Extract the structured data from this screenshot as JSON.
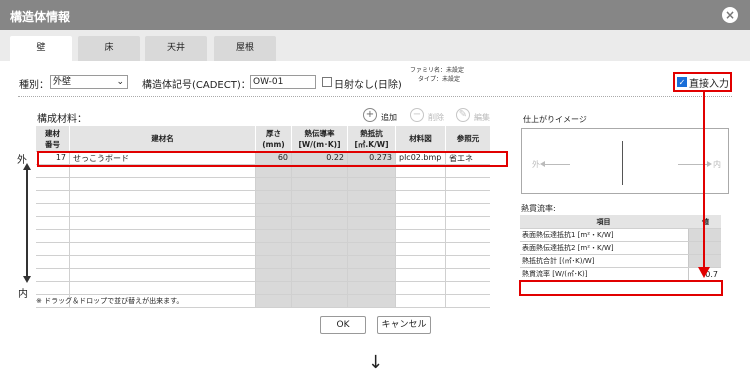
{
  "window": {
    "title": "構造体情報",
    "close_label": "×"
  },
  "tabs": [
    {
      "label": "壁",
      "active": true
    },
    {
      "label": "床",
      "active": false
    },
    {
      "label": "天井",
      "active": false
    },
    {
      "label": "屋根",
      "active": false
    }
  ],
  "form": {
    "type_label": "種別：",
    "type_value": "外壁",
    "code_label": "構造体記号(CADECT)：",
    "code_value": "OW-01",
    "no_sun_label": "日射なし(日除)",
    "family_text": "ファミリ名：未設定",
    "type_text": "タイプ：未設定",
    "direct_input_label": "直接入力"
  },
  "materials": {
    "section_label": "構成材料：",
    "add_label": "追加",
    "delete_label": "削除",
    "edit_label": "編集",
    "headers": [
      "建材\n番号",
      "建材名",
      "厚さ\n(mm)",
      "熱伝導率\n[W/(m･K)]",
      "熱抵抗\n[㎡.K/W]",
      "材料図",
      "参照元"
    ],
    "rows": [
      {
        "no": "17",
        "name": "せっこうボード",
        "thickness": "60",
        "conductivity": "0.22",
        "resistance": "0.273",
        "figure": "plc02.bmp",
        "source": "省エネ"
      }
    ],
    "outside_label": "外",
    "inside_label": "内",
    "note": "※ ドラッグ＆ドロップで並び替えが出来ます。"
  },
  "preview": {
    "title": "仕上がりイメージ",
    "out_label": "外",
    "in_label": "内"
  },
  "heat": {
    "title": "熱貫流率:",
    "header_item": "項目",
    "header_value": "値",
    "rows": [
      {
        "item": "表面熱伝達抵抗1 [m²・K/W]",
        "value": ""
      },
      {
        "item": "表面熱伝達抵抗2 [m²・K/W]",
        "value": ""
      },
      {
        "item": "熱抵抗合計 [(㎡･K)/W]",
        "value": ""
      },
      {
        "item": "熱貫流率 [W/(㎡･K)]",
        "value": "0.7"
      }
    ]
  },
  "buttons": {
    "ok": "OK",
    "cancel": "キャンセル"
  },
  "arrow_glyph": "↓",
  "colors": {
    "titlebar": "#868686",
    "highlight": "#e10000",
    "checkbox": "#1a6ed8"
  }
}
